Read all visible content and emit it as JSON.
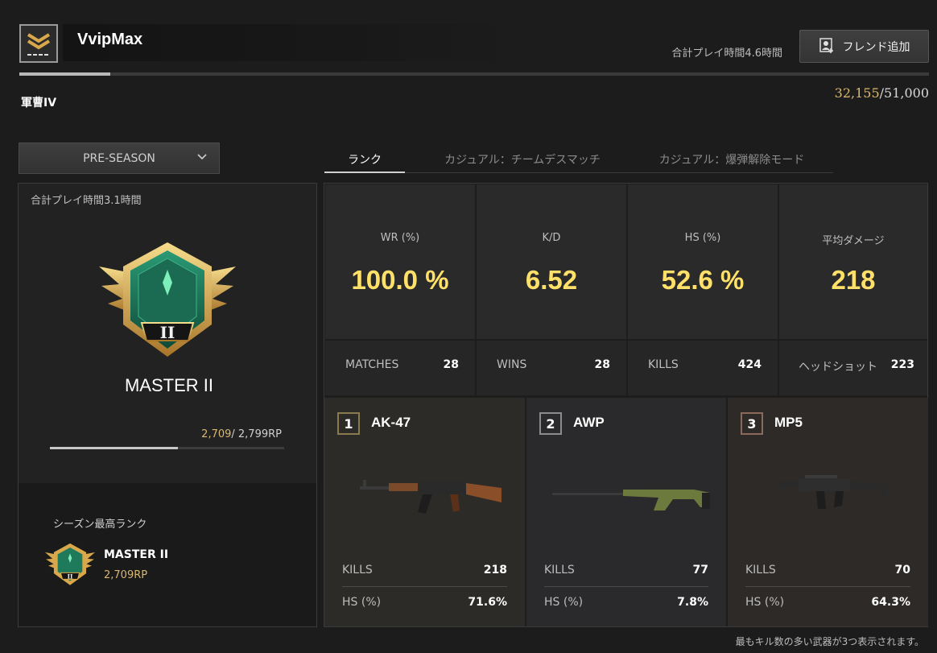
{
  "header": {
    "player_name": "VvipMax",
    "total_play_time": "合計プレイ時間4.6時間",
    "friend_button_label": "フレンド追加",
    "rank_title": "軍曹IV",
    "xp_current": "32,155",
    "xp_total": "/51,000",
    "xp_progress": 0.1
  },
  "season_select": {
    "selected": "PRE-SEASON"
  },
  "left_panel": {
    "play_time": "合計プレイ時間3.1時間",
    "tier_name": "MASTER II",
    "emblem_numeral": "II",
    "rp_current": "2,709",
    "rp_rest": "/  2,799RP",
    "rp_progress": 0.545,
    "best_rank_label": "シーズン最高ランク",
    "best_tier": "MASTER II",
    "best_rp": "2,709RP"
  },
  "tabs": [
    {
      "label": "ランク",
      "active": true
    },
    {
      "label": "カジュアル：チームデスマッチ",
      "active": false
    },
    {
      "label": "カジュアル：爆弾解除モード",
      "active": false
    }
  ],
  "stats": [
    {
      "label": "WR (%)",
      "value": "100.0 %"
    },
    {
      "label": "K/D",
      "value": "6.52"
    },
    {
      "label": "HS (%)",
      "value": "52.6 %"
    },
    {
      "label": "平均ダメージ",
      "value": "218"
    }
  ],
  "counts": [
    {
      "label": "MATCHES",
      "value": "28"
    },
    {
      "label": "WINS",
      "value": "28"
    },
    {
      "label": "KILLS",
      "value": "424"
    },
    {
      "label": "ヘッドショット",
      "value": "223"
    }
  ],
  "weapons": [
    {
      "rank": "1",
      "name": "AK-47",
      "kills_label": "KILLS",
      "kills": "218",
      "hs_label": "HS (%)",
      "hs": "71.6%",
      "accent": "#8a7b4e",
      "bg": "#2d2b27"
    },
    {
      "rank": "2",
      "name": "AWP",
      "kills_label": "KILLS",
      "kills": "77",
      "hs_label": "HS (%)",
      "hs": "7.8%",
      "accent": "#8c8c8c",
      "bg": "#2a2a2c"
    },
    {
      "rank": "3",
      "name": "MP5",
      "kills_label": "KILLS",
      "kills": "70",
      "hs_label": "HS (%)",
      "hs": "64.3%",
      "accent": "#8a6a5a",
      "bg": "#2d2a28"
    }
  ],
  "footnote": "最もキル数の多い武器が3つ表示されます。",
  "colors": {
    "stat_value": "#ffe169",
    "rp_gold": "#d9b870",
    "emblem_green": "#1f7a5c",
    "emblem_gold": "#d8a84a"
  }
}
